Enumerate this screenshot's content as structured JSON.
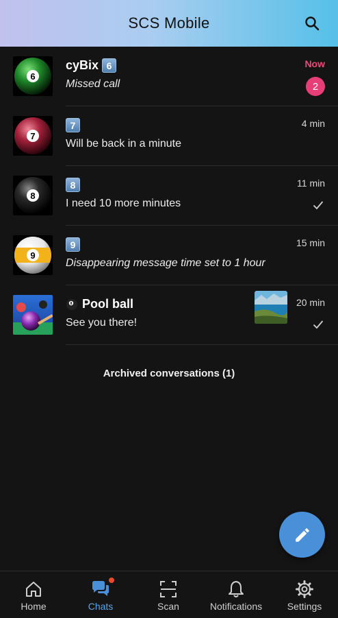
{
  "header": {
    "title": "SCS Mobile",
    "search_icon": "search-icon"
  },
  "chats": [
    {
      "name": "cyBix",
      "badge": "6",
      "preview": "Missed call",
      "time": "Now",
      "unread": "2"
    },
    {
      "name": "",
      "badge": "7",
      "preview": "Will be back in a minute",
      "time": "4 min"
    },
    {
      "name": "",
      "badge": "8",
      "preview": "I need 10 more minutes",
      "time": "11 min",
      "status": "check-icon"
    },
    {
      "name": "",
      "badge": "9",
      "preview": "Disappearing message time set to 1 hour",
      "time": "15 min"
    },
    {
      "name": "Pool ball",
      "preview": "See you there!",
      "time": "20 min",
      "status": "check-icon"
    }
  ],
  "archived": "Archived conversations (1)",
  "fab": {
    "icon": "pencil-icon"
  },
  "nav": [
    {
      "label": "Home",
      "icon": "home-icon"
    },
    {
      "label": "Chats",
      "icon": "chat-bubbles-icon"
    },
    {
      "label": "Scan",
      "icon": "scan-icon"
    },
    {
      "label": "Notifications",
      "icon": "bell-icon"
    },
    {
      "label": "Settings",
      "icon": "gear-icon"
    }
  ],
  "colors": {
    "accent": "#4a90d9",
    "unread": "#e83e77",
    "header_start": "#c2c1ee",
    "header_end": "#55c0e8"
  }
}
